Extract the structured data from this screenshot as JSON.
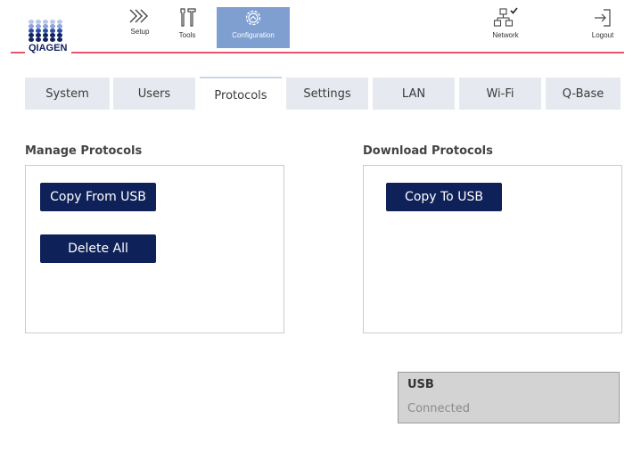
{
  "brand": {
    "logo_text": "QIAGEN",
    "dot_colors": [
      "#b9c6e6",
      "#8da3d6",
      "#2b4fa3",
      "#12225f"
    ],
    "accent_line_color": "#e8546e"
  },
  "header": {
    "nav": [
      {
        "label": "Setup",
        "icon": "setup-chevrons-icon",
        "active": false
      },
      {
        "label": "Tools",
        "icon": "tools-icon",
        "active": false
      },
      {
        "label": "Configuration",
        "icon": "configuration-gear-icon",
        "active": true
      },
      {
        "label": "Network",
        "icon": "network-icon",
        "active": false
      },
      {
        "label": "Logout",
        "icon": "logout-icon",
        "active": false
      }
    ]
  },
  "tabs": [
    {
      "label": "System",
      "active": false
    },
    {
      "label": "Users",
      "active": false
    },
    {
      "label": "Protocols",
      "active": true
    },
    {
      "label": "Settings",
      "active": false
    },
    {
      "label": "LAN",
      "active": false
    },
    {
      "label": "Wi-Fi",
      "active": false
    },
    {
      "label": "Q-Base",
      "active": false
    }
  ],
  "manage_protocols": {
    "title": "Manage Protocols",
    "copy_from_usb_label": "Copy From USB",
    "delete_all_label": "Delete All"
  },
  "download_protocols": {
    "title": "Download Protocols",
    "copy_to_usb_label": "Copy To USB"
  },
  "usb": {
    "title": "USB",
    "status": "Connected"
  },
  "colors": {
    "button_bg": "#0f2159",
    "active_nav_bg": "#7e9fd0",
    "tab_bg": "#e6eaf0",
    "usb_box_bg": "#d3d3d3"
  }
}
